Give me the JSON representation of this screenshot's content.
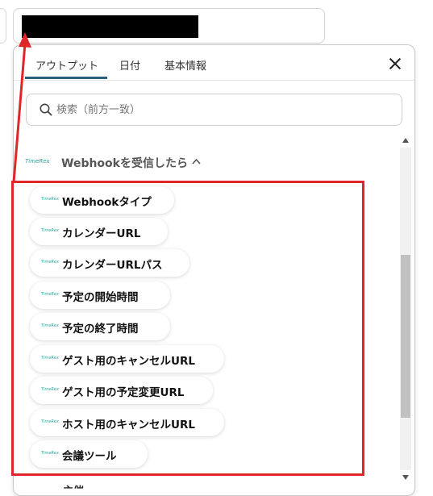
{
  "annotation": {
    "color": "#e0262b"
  },
  "panel": {
    "tabs": [
      {
        "label": "アウトプット",
        "active": true
      },
      {
        "label": "日付",
        "active": false
      },
      {
        "label": "基本情報",
        "active": false
      }
    ],
    "close_icon": "close-icon",
    "search": {
      "placeholder": "検索（前方一致）",
      "value": "",
      "icon": "search-icon"
    },
    "section": {
      "logo_text": "TimeRex",
      "title": "Webhookを受信したら",
      "expanded": true,
      "items": [
        {
          "label": "Webhookタイプ"
        },
        {
          "label": "カレンダーURL"
        },
        {
          "label": "カレンダーURLパス"
        },
        {
          "label": "予定の開始時間"
        },
        {
          "label": "予定の終了時間"
        },
        {
          "label": "ゲスト用のキャンセルURL"
        },
        {
          "label": "ゲスト用の予定変更URL"
        },
        {
          "label": "ホスト用のキャンセルURL"
        },
        {
          "label": "会議ツール"
        }
      ],
      "partially_visible_next": "主催"
    }
  },
  "accent_color": "#2b5f7e"
}
